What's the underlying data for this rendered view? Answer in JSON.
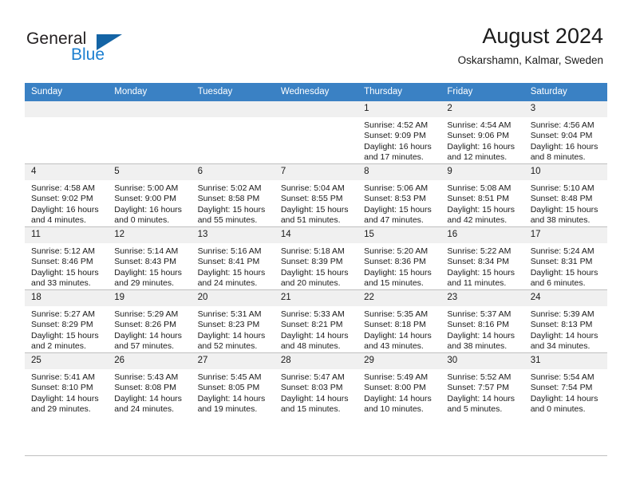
{
  "brand": {
    "name_part1": "General",
    "name_part2": "Blue",
    "mark": "triangle-logo-icon",
    "accent_color": "#1c7fd0",
    "mark_color": "#1464a5"
  },
  "header": {
    "title": "August 2024",
    "location": "Oskarshamn, Kalmar, Sweden"
  },
  "theme": {
    "header_row_bg": "#3a81c4",
    "daynum_bg": "#f0f0f0",
    "grid_line": "#bfbfbf",
    "text": "#1a1a1a"
  },
  "weekday_headers": [
    "Sunday",
    "Monday",
    "Tuesday",
    "Wednesday",
    "Thursday",
    "Friday",
    "Saturday"
  ],
  "labels": {
    "sunrise_prefix": "Sunrise:",
    "sunset_prefix": "Sunset:",
    "daylight_prefix": "Daylight:"
  },
  "weeks": [
    [
      {
        "day": "",
        "empty": true,
        "line1": "",
        "line2": "",
        "line3": "",
        "line4": ""
      },
      {
        "day": "",
        "empty": true,
        "line1": "",
        "line2": "",
        "line3": "",
        "line4": ""
      },
      {
        "day": "",
        "empty": true,
        "line1": "",
        "line2": "",
        "line3": "",
        "line4": ""
      },
      {
        "day": "",
        "empty": true,
        "line1": "",
        "line2": "",
        "line3": "",
        "line4": ""
      },
      {
        "day": "1",
        "empty": false,
        "line1": "Sunrise: 4:52 AM",
        "line2": "Sunset: 9:09 PM",
        "line3": "Daylight: 16 hours",
        "line4": "and 17 minutes."
      },
      {
        "day": "2",
        "empty": false,
        "line1": "Sunrise: 4:54 AM",
        "line2": "Sunset: 9:06 PM",
        "line3": "Daylight: 16 hours",
        "line4": "and 12 minutes."
      },
      {
        "day": "3",
        "empty": false,
        "line1": "Sunrise: 4:56 AM",
        "line2": "Sunset: 9:04 PM",
        "line3": "Daylight: 16 hours",
        "line4": "and 8 minutes."
      }
    ],
    [
      {
        "day": "4",
        "empty": false,
        "line1": "Sunrise: 4:58 AM",
        "line2": "Sunset: 9:02 PM",
        "line3": "Daylight: 16 hours",
        "line4": "and 4 minutes."
      },
      {
        "day": "5",
        "empty": false,
        "line1": "Sunrise: 5:00 AM",
        "line2": "Sunset: 9:00 PM",
        "line3": "Daylight: 16 hours",
        "line4": "and 0 minutes."
      },
      {
        "day": "6",
        "empty": false,
        "line1": "Sunrise: 5:02 AM",
        "line2": "Sunset: 8:58 PM",
        "line3": "Daylight: 15 hours",
        "line4": "and 55 minutes."
      },
      {
        "day": "7",
        "empty": false,
        "line1": "Sunrise: 5:04 AM",
        "line2": "Sunset: 8:55 PM",
        "line3": "Daylight: 15 hours",
        "line4": "and 51 minutes."
      },
      {
        "day": "8",
        "empty": false,
        "line1": "Sunrise: 5:06 AM",
        "line2": "Sunset: 8:53 PM",
        "line3": "Daylight: 15 hours",
        "line4": "and 47 minutes."
      },
      {
        "day": "9",
        "empty": false,
        "line1": "Sunrise: 5:08 AM",
        "line2": "Sunset: 8:51 PM",
        "line3": "Daylight: 15 hours",
        "line4": "and 42 minutes."
      },
      {
        "day": "10",
        "empty": false,
        "line1": "Sunrise: 5:10 AM",
        "line2": "Sunset: 8:48 PM",
        "line3": "Daylight: 15 hours",
        "line4": "and 38 minutes."
      }
    ],
    [
      {
        "day": "11",
        "empty": false,
        "line1": "Sunrise: 5:12 AM",
        "line2": "Sunset: 8:46 PM",
        "line3": "Daylight: 15 hours",
        "line4": "and 33 minutes."
      },
      {
        "day": "12",
        "empty": false,
        "line1": "Sunrise: 5:14 AM",
        "line2": "Sunset: 8:43 PM",
        "line3": "Daylight: 15 hours",
        "line4": "and 29 minutes."
      },
      {
        "day": "13",
        "empty": false,
        "line1": "Sunrise: 5:16 AM",
        "line2": "Sunset: 8:41 PM",
        "line3": "Daylight: 15 hours",
        "line4": "and 24 minutes."
      },
      {
        "day": "14",
        "empty": false,
        "line1": "Sunrise: 5:18 AM",
        "line2": "Sunset: 8:39 PM",
        "line3": "Daylight: 15 hours",
        "line4": "and 20 minutes."
      },
      {
        "day": "15",
        "empty": false,
        "line1": "Sunrise: 5:20 AM",
        "line2": "Sunset: 8:36 PM",
        "line3": "Daylight: 15 hours",
        "line4": "and 15 minutes."
      },
      {
        "day": "16",
        "empty": false,
        "line1": "Sunrise: 5:22 AM",
        "line2": "Sunset: 8:34 PM",
        "line3": "Daylight: 15 hours",
        "line4": "and 11 minutes."
      },
      {
        "day": "17",
        "empty": false,
        "line1": "Sunrise: 5:24 AM",
        "line2": "Sunset: 8:31 PM",
        "line3": "Daylight: 15 hours",
        "line4": "and 6 minutes."
      }
    ],
    [
      {
        "day": "18",
        "empty": false,
        "line1": "Sunrise: 5:27 AM",
        "line2": "Sunset: 8:29 PM",
        "line3": "Daylight: 15 hours",
        "line4": "and 2 minutes."
      },
      {
        "day": "19",
        "empty": false,
        "line1": "Sunrise: 5:29 AM",
        "line2": "Sunset: 8:26 PM",
        "line3": "Daylight: 14 hours",
        "line4": "and 57 minutes."
      },
      {
        "day": "20",
        "empty": false,
        "line1": "Sunrise: 5:31 AM",
        "line2": "Sunset: 8:23 PM",
        "line3": "Daylight: 14 hours",
        "line4": "and 52 minutes."
      },
      {
        "day": "21",
        "empty": false,
        "line1": "Sunrise: 5:33 AM",
        "line2": "Sunset: 8:21 PM",
        "line3": "Daylight: 14 hours",
        "line4": "and 48 minutes."
      },
      {
        "day": "22",
        "empty": false,
        "line1": "Sunrise: 5:35 AM",
        "line2": "Sunset: 8:18 PM",
        "line3": "Daylight: 14 hours",
        "line4": "and 43 minutes."
      },
      {
        "day": "23",
        "empty": false,
        "line1": "Sunrise: 5:37 AM",
        "line2": "Sunset: 8:16 PM",
        "line3": "Daylight: 14 hours",
        "line4": "and 38 minutes."
      },
      {
        "day": "24",
        "empty": false,
        "line1": "Sunrise: 5:39 AM",
        "line2": "Sunset: 8:13 PM",
        "line3": "Daylight: 14 hours",
        "line4": "and 34 minutes."
      }
    ],
    [
      {
        "day": "25",
        "empty": false,
        "line1": "Sunrise: 5:41 AM",
        "line2": "Sunset: 8:10 PM",
        "line3": "Daylight: 14 hours",
        "line4": "and 29 minutes."
      },
      {
        "day": "26",
        "empty": false,
        "line1": "Sunrise: 5:43 AM",
        "line2": "Sunset: 8:08 PM",
        "line3": "Daylight: 14 hours",
        "line4": "and 24 minutes."
      },
      {
        "day": "27",
        "empty": false,
        "line1": "Sunrise: 5:45 AM",
        "line2": "Sunset: 8:05 PM",
        "line3": "Daylight: 14 hours",
        "line4": "and 19 minutes."
      },
      {
        "day": "28",
        "empty": false,
        "line1": "Sunrise: 5:47 AM",
        "line2": "Sunset: 8:03 PM",
        "line3": "Daylight: 14 hours",
        "line4": "and 15 minutes."
      },
      {
        "day": "29",
        "empty": false,
        "line1": "Sunrise: 5:49 AM",
        "line2": "Sunset: 8:00 PM",
        "line3": "Daylight: 14 hours",
        "line4": "and 10 minutes."
      },
      {
        "day": "30",
        "empty": false,
        "line1": "Sunrise: 5:52 AM",
        "line2": "Sunset: 7:57 PM",
        "line3": "Daylight: 14 hours",
        "line4": "and 5 minutes."
      },
      {
        "day": "31",
        "empty": false,
        "line1": "Sunrise: 5:54 AM",
        "line2": "Sunset: 7:54 PM",
        "line3": "Daylight: 14 hours",
        "line4": "and 0 minutes."
      }
    ]
  ]
}
